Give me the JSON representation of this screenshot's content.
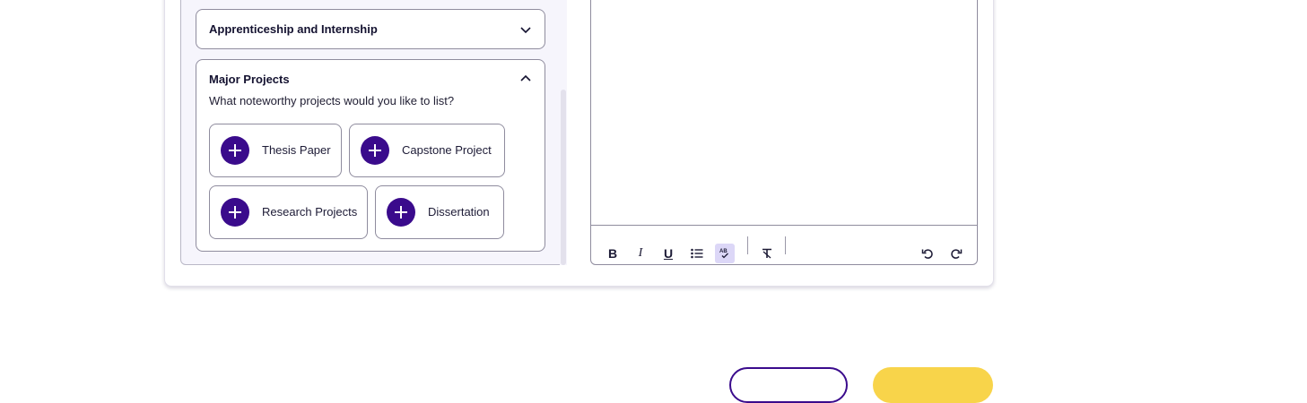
{
  "sections": {
    "collapsed_title": "Apprenticeship and Internship",
    "open_title": "Major Projects",
    "open_prompt": "What noteworthy projects would you like to list?",
    "chips": [
      {
        "label": "Thesis Paper"
      },
      {
        "label": "Capstone Project"
      },
      {
        "label": "Research Projects"
      },
      {
        "label": "Dissertation"
      }
    ]
  },
  "editor": {
    "toolbar": {
      "bold": "B",
      "italic": "I",
      "underline": "U",
      "list_icon": "bulleted-list-icon",
      "spellcheck_icon": "spellcheck-icon",
      "clear_format_icon": "clear-formatting-icon",
      "undo_icon": "undo-icon",
      "redo_icon": "redo-icon"
    }
  },
  "colors": {
    "accent": "#3a0b8c",
    "highlight": "#f8d44a",
    "active_tool": "#dcd7f7"
  }
}
